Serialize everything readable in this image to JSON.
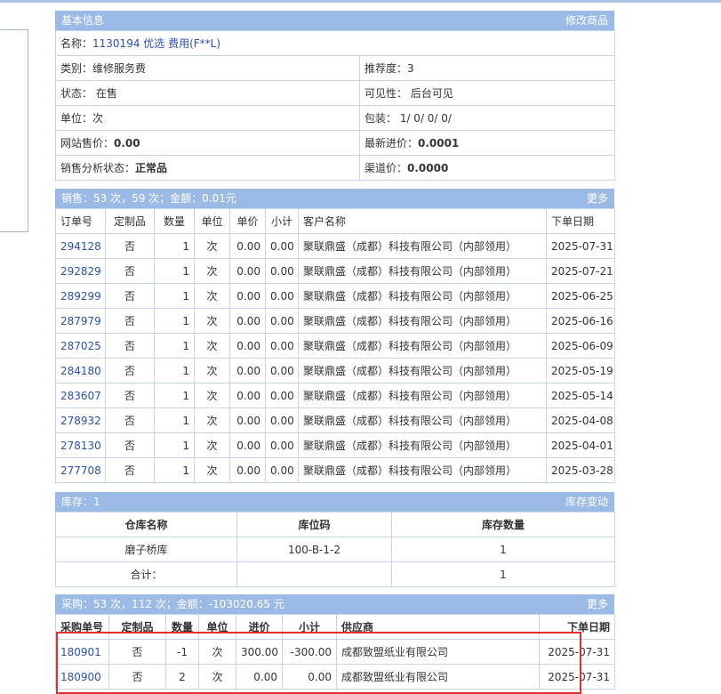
{
  "basic": {
    "title": "基本信息",
    "edit_link": "修改商品",
    "name_label": "名称：",
    "name_value": "1130194 优选 费用(F**L)",
    "category": "类别：维修服务费",
    "recommend": "推荐度：3",
    "status": "状态： 在售",
    "visibility": "可见性： 后台可见",
    "unit": "单位：次",
    "package": "包装： 1/ 0/ 0/ 0/",
    "site_price_label": "网站售价：",
    "site_price_value": "0.00",
    "latest_cost_label": "最新进价：",
    "latest_cost_value": "0.0001",
    "sales_status_label": "销售分析状态：",
    "sales_status_value": "正常品",
    "channel_price_label": "渠道价：",
    "channel_price_value": "0.0000"
  },
  "sales": {
    "title": "销售：53 次，59 次；金额：0.01元",
    "more": "更多",
    "headers": [
      "订单号",
      "定制品",
      "数量",
      "单位",
      "单价",
      "小计",
      "客户名称",
      "下单日期"
    ],
    "rows": [
      [
        "294128",
        "否",
        "1",
        "次",
        "0.00",
        "0.00",
        "聚联鼎盛（成都）科技有限公司（内部领用）",
        "2025-07-31"
      ],
      [
        "292829",
        "否",
        "1",
        "次",
        "0.00",
        "0.00",
        "聚联鼎盛（成都）科技有限公司（内部领用）",
        "2025-07-21"
      ],
      [
        "289299",
        "否",
        "1",
        "次",
        "0.00",
        "0.00",
        "聚联鼎盛（成都）科技有限公司（内部领用）",
        "2025-06-25"
      ],
      [
        "287979",
        "否",
        "1",
        "次",
        "0.00",
        "0.00",
        "聚联鼎盛（成都）科技有限公司（内部领用）",
        "2025-06-16"
      ],
      [
        "287025",
        "否",
        "1",
        "次",
        "0.00",
        "0.00",
        "聚联鼎盛（成都）科技有限公司（内部领用）",
        "2025-06-09"
      ],
      [
        "284180",
        "否",
        "1",
        "次",
        "0.00",
        "0.00",
        "聚联鼎盛（成都）科技有限公司（内部领用）",
        "2025-05-19"
      ],
      [
        "283607",
        "否",
        "1",
        "次",
        "0.00",
        "0.00",
        "聚联鼎盛（成都）科技有限公司（内部领用）",
        "2025-05-14"
      ],
      [
        "278932",
        "否",
        "1",
        "次",
        "0.00",
        "0.00",
        "聚联鼎盛（成都）科技有限公司（内部领用）",
        "2025-04-08"
      ],
      [
        "278130",
        "否",
        "1",
        "次",
        "0.00",
        "0.00",
        "聚联鼎盛（成都）科技有限公司（内部领用）",
        "2025-04-01"
      ],
      [
        "277708",
        "否",
        "1",
        "次",
        "0.00",
        "0.00",
        "聚联鼎盛（成都）科技有限公司（内部领用）",
        "2025-03-28"
      ]
    ]
  },
  "stock": {
    "title": "库存：1",
    "change_link": "库存变动",
    "headers": [
      "仓库名称",
      "库位码",
      "库存数量"
    ],
    "rows": [
      [
        "磨子桥库",
        "100-B-1-2",
        "1"
      ]
    ],
    "total_label": "合计：",
    "total_value": "1"
  },
  "purchase": {
    "title": "采购：53 次，112 次；金额：-103020.65 元",
    "more": "更多",
    "headers": [
      "采购单号",
      "定制品",
      "数量",
      "单位",
      "进价",
      "小计",
      "供应商",
      "下单日期"
    ],
    "rows": [
      [
        "180901",
        "否",
        "-1",
        "次",
        "300.00",
        "-300.00",
        "成都致盟纸业有限公司",
        "2025-07-31"
      ],
      [
        "180900",
        "否",
        "2",
        "次",
        "0.00",
        "0.00",
        "成都致盟纸业有限公司",
        "2025-07-31"
      ]
    ]
  },
  "colors": {
    "header_bg": "#9bbbe6",
    "link": "#2a4fb8",
    "highlight": "#e0322a"
  }
}
